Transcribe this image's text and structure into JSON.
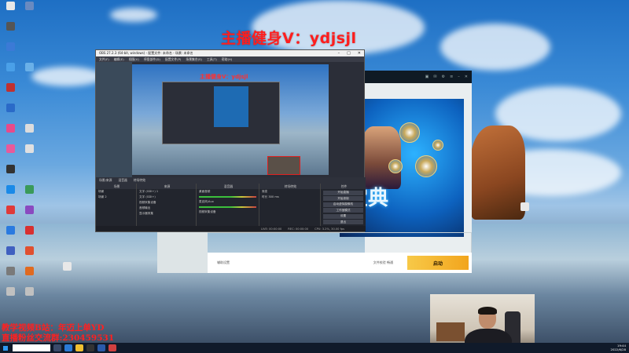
{
  "overlay": {
    "streamer_id": "主播健身V：ydjsjl",
    "promo_line1": "教学视频B站：年迈上单YD",
    "promo_line2": "直播粉丝交流群:230459531"
  },
  "obs": {
    "title": "OBS 27.2.3 (64-bit, windows) - 配置文件: 未命名 - 场景: 未命名",
    "menu": [
      "文件(F)",
      "编辑(E)",
      "视图(V)",
      "停靠部件(D)",
      "配置文件(P)",
      "场景集合(S)",
      "工具(T)",
      "帮助(H)"
    ],
    "preview_text": "主播健身V：ydjsjl",
    "tabs": [
      "场景/来源",
      "混音器",
      "转场特效"
    ],
    "docks": {
      "scenes": {
        "header": "场景",
        "items": [
          "场景",
          "场景 2"
        ]
      },
      "sources": {
        "header": "来源",
        "items": [
          "文字 (GDI+) 1",
          "文字 (GDI+)",
          "视频采集设备",
          "音频输出",
          "显示器采集"
        ]
      },
      "mixer": {
        "header": "混音器",
        "items": [
          "桌面音频",
          "麦克风/Aux",
          "视频采集设备"
        ]
      },
      "transition": {
        "header": "转场特效",
        "fade": "渐变",
        "duration_label": "时长",
        "duration_value": "300 ms"
      },
      "controls": {
        "header": "控件",
        "buttons": [
          "开始直播",
          "开始录制",
          "启动虚拟摄像机",
          "工作室模式",
          "设置",
          "退出"
        ]
      }
    },
    "status": [
      "LIVE: 00:00:00",
      "REC: 00:00:00",
      "CPU: 3.2%, 30.00 fps"
    ]
  },
  "launcher": {
    "banner_text": "宝典",
    "settings_label": "辅助设置",
    "status_text": "文件校验 畅通",
    "launch_label": "启动"
  },
  "taskbar": {
    "time": "19:44",
    "date": "2022/6/28"
  }
}
